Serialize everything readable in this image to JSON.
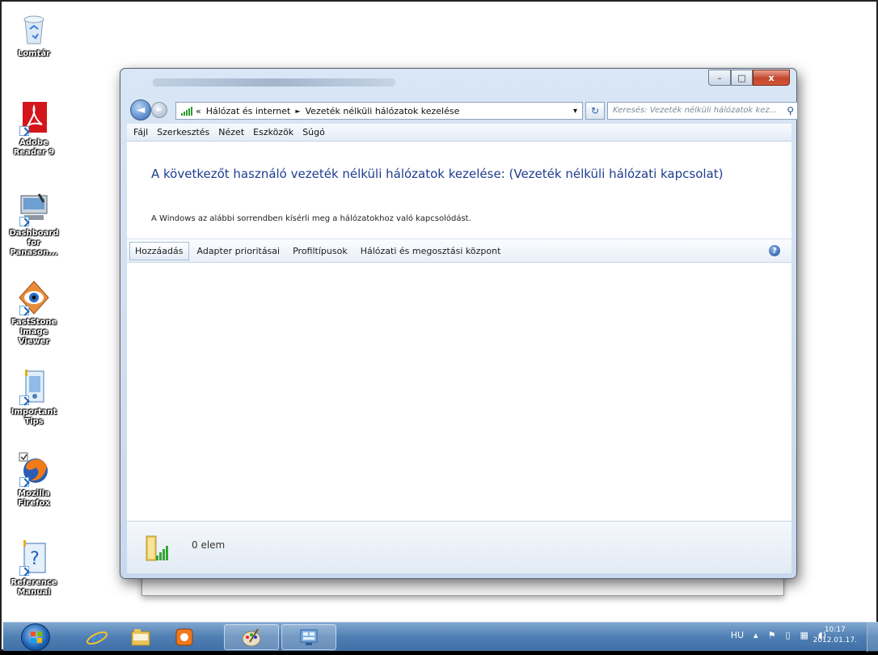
{
  "desktop": {
    "icons": [
      {
        "label": "Lomtár",
        "icon": "recycle-bin-icon"
      },
      {
        "label": "Adobe Reader 9",
        "icon": "adobe-reader-icon"
      },
      {
        "label": "Dashboard for Panason...",
        "icon": "dashboard-icon"
      },
      {
        "label": "FastStone Image Viewer",
        "icon": "faststone-icon"
      },
      {
        "label": "Important Tips",
        "icon": "tips-icon"
      },
      {
        "label": "Mozilla Firefox",
        "icon": "firefox-icon"
      },
      {
        "label": "Reference Manual",
        "icon": "manual-icon"
      }
    ]
  },
  "window": {
    "controls": {
      "minimize": "–",
      "maximize": "□",
      "close": "x"
    },
    "address": {
      "prefix": "«",
      "segments": [
        "Hálózat és internet",
        "Vezeték nélküli hálózatok kezelése"
      ],
      "separator": "►",
      "dropdown": "▾"
    },
    "search_placeholder": "Keresés: Vezeték nélküli hálózatok kez...",
    "menu": [
      "Fájl",
      "Szerkesztés",
      "Nézet",
      "Eszközök",
      "Súgó"
    ],
    "heading": "A következőt használó vezeték nélküli hálózatok kezelése: (Vezeték nélküli hálózati kapcsolat)",
    "description": "A Windows az alábbi sorrendben kísérli meg a hálózatokhoz való kapcsolódást.",
    "commands": [
      "Hozzáadás",
      "Adapter prioritásai",
      "Profiltípusok",
      "Hálózati és megosztási központ"
    ],
    "status_count": "0 elem"
  },
  "taskbar": {
    "language": "HU",
    "time": "10:17",
    "date": "2012.01.17.",
    "pinned": [
      "start-orb",
      "internet-explorer-icon",
      "explorer-icon",
      "media-player-icon",
      "paint-icon",
      "network-window-icon"
    ]
  },
  "colors": {
    "heading": "#1e3d8f",
    "taskbar": "#4f7fb3",
    "close_button": "#c4462c"
  }
}
